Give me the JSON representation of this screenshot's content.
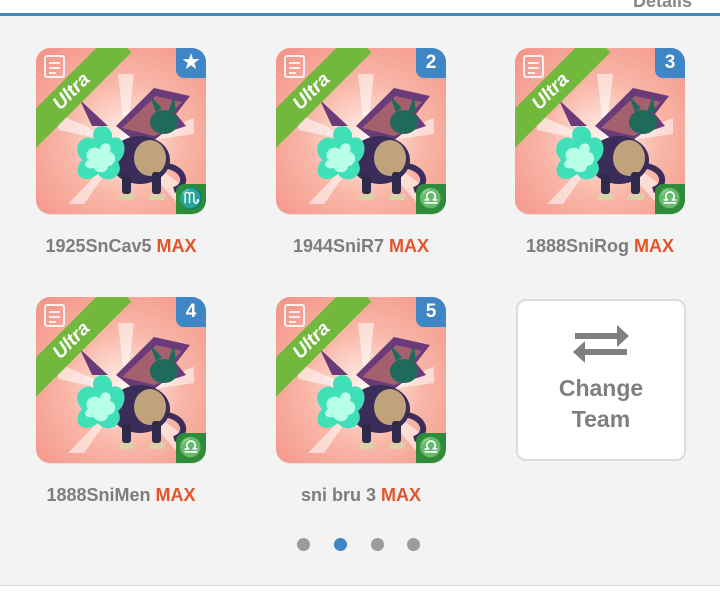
{
  "header": {
    "details_label": "Details"
  },
  "team": [
    {
      "name": "1925SnCav5",
      "max": "MAX",
      "tier": "Ultra",
      "slot": "★",
      "sign": "♏"
    },
    {
      "name": "1944SniR7",
      "max": "MAX",
      "tier": "Ultra",
      "slot": "2",
      "sign": "♎"
    },
    {
      "name": "1888SniRog",
      "max": "MAX",
      "tier": "Ultra",
      "slot": "3",
      "sign": "♎"
    },
    {
      "name": "1888SniMen",
      "max": "MAX",
      "tier": "Ultra",
      "slot": "4",
      "sign": "♎"
    },
    {
      "name": "sni bru 3",
      "max": "MAX",
      "tier": "Ultra",
      "slot": "5",
      "sign": "♎"
    }
  ],
  "change_team": {
    "line1": "Change",
    "line2": "Team",
    "icon": "swap-arrows-icon"
  },
  "pagination": {
    "total": 4,
    "active_index": 1
  },
  "colors": {
    "accent_blue": "#3f86c6",
    "ultra_green": "#71b83c",
    "sign_green": "#2e8b3a",
    "max_orange": "#e2542a"
  }
}
